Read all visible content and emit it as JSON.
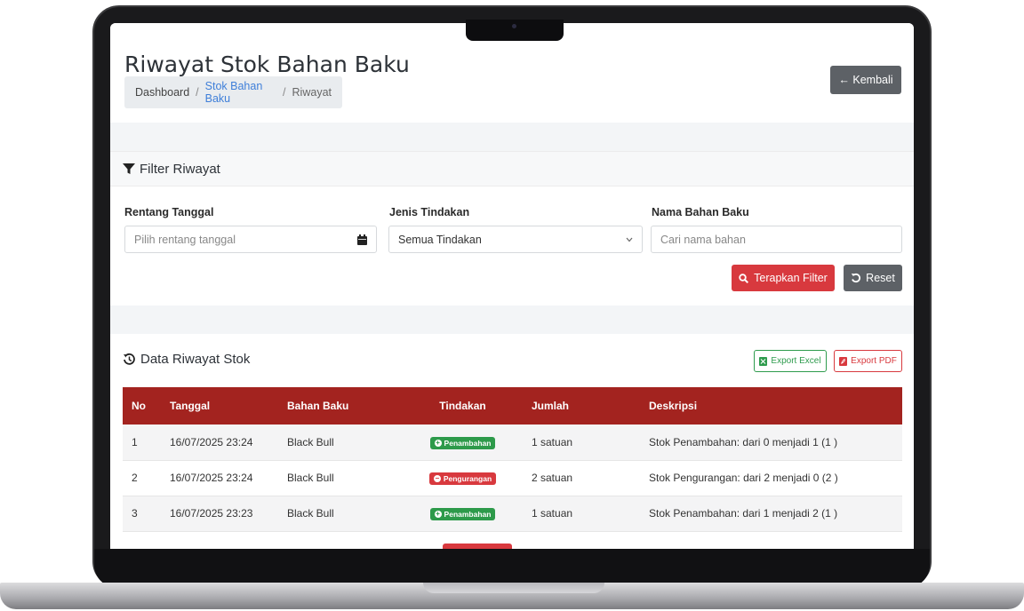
{
  "header": {
    "title": "Riwayat Stok Bahan Baku",
    "back_button": "← Kembali",
    "breadcrumb": {
      "home": "Dashboard",
      "parent": "Stok Bahan Baku",
      "current": "Riwayat",
      "separator": "/"
    }
  },
  "filter": {
    "title": "Filter Riwayat",
    "date_label": "Rentang Tanggal",
    "date_placeholder": "Pilih rentang tanggal",
    "action_label": "Jenis Tindakan",
    "action_value": "Semua Tindakan",
    "name_label": "Nama Bahan Baku",
    "name_placeholder": "Cari nama bahan",
    "apply_button": "Terapkan Filter",
    "reset_button": "Reset"
  },
  "data": {
    "title": "Data Riwayat Stok",
    "export_excel": "Export Excel",
    "export_pdf": "Export PDF",
    "columns": [
      "No",
      "Tanggal",
      "Bahan Baku",
      "Tindakan",
      "Jumlah",
      "Deskripsi"
    ],
    "rows": [
      {
        "no": "1",
        "date": "16/07/2025 23:24",
        "item": "Black Bull",
        "action": "Penambahan",
        "type": "add",
        "amount": "1 satuan",
        "desc": "Stok Penambahan: dari 0 menjadi 1 (1 )"
      },
      {
        "no": "2",
        "date": "16/07/2025 23:24",
        "item": "Black Bull",
        "action": "Pengurangan",
        "type": "sub",
        "amount": "2 satuan",
        "desc": "Stok Pengurangan: dari 2 menjadi 0 (2 )"
      },
      {
        "no": "3",
        "date": "16/07/2025 23:23",
        "item": "Black Bull",
        "action": "Penambahan",
        "type": "add",
        "amount": "1 satuan",
        "desc": "Stok Penambahan: dari 1 menjadi 2 (1 )"
      }
    ]
  },
  "colors": {
    "table_header": "#a3231f",
    "primary_danger": "#d8393e",
    "success": "#2d9a4a",
    "secondary": "#5d6166",
    "link": "#3f7fd9"
  }
}
